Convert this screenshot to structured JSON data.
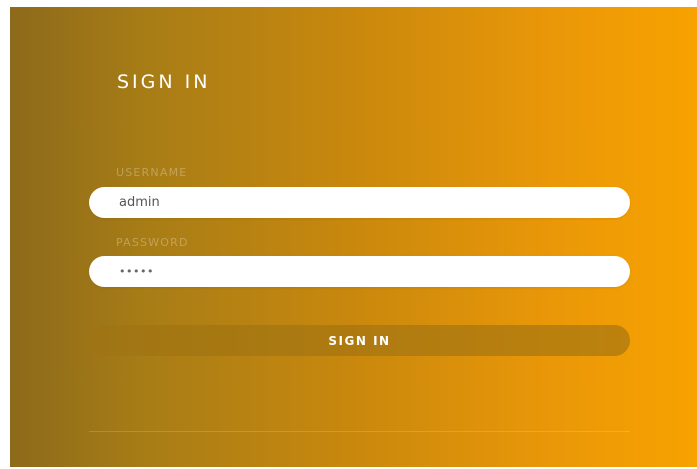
{
  "form": {
    "title": "SIGN IN",
    "username_label": "USERNAME",
    "username_value": "admin",
    "password_label": "PASSWORD",
    "password_value": "•••••",
    "submit_label": "SIGN IN"
  },
  "colors": {
    "gradient_start": "#8d6a1b",
    "gradient_end": "#f7a200",
    "input_background": "#ffffff",
    "button_background": "#a07312"
  }
}
